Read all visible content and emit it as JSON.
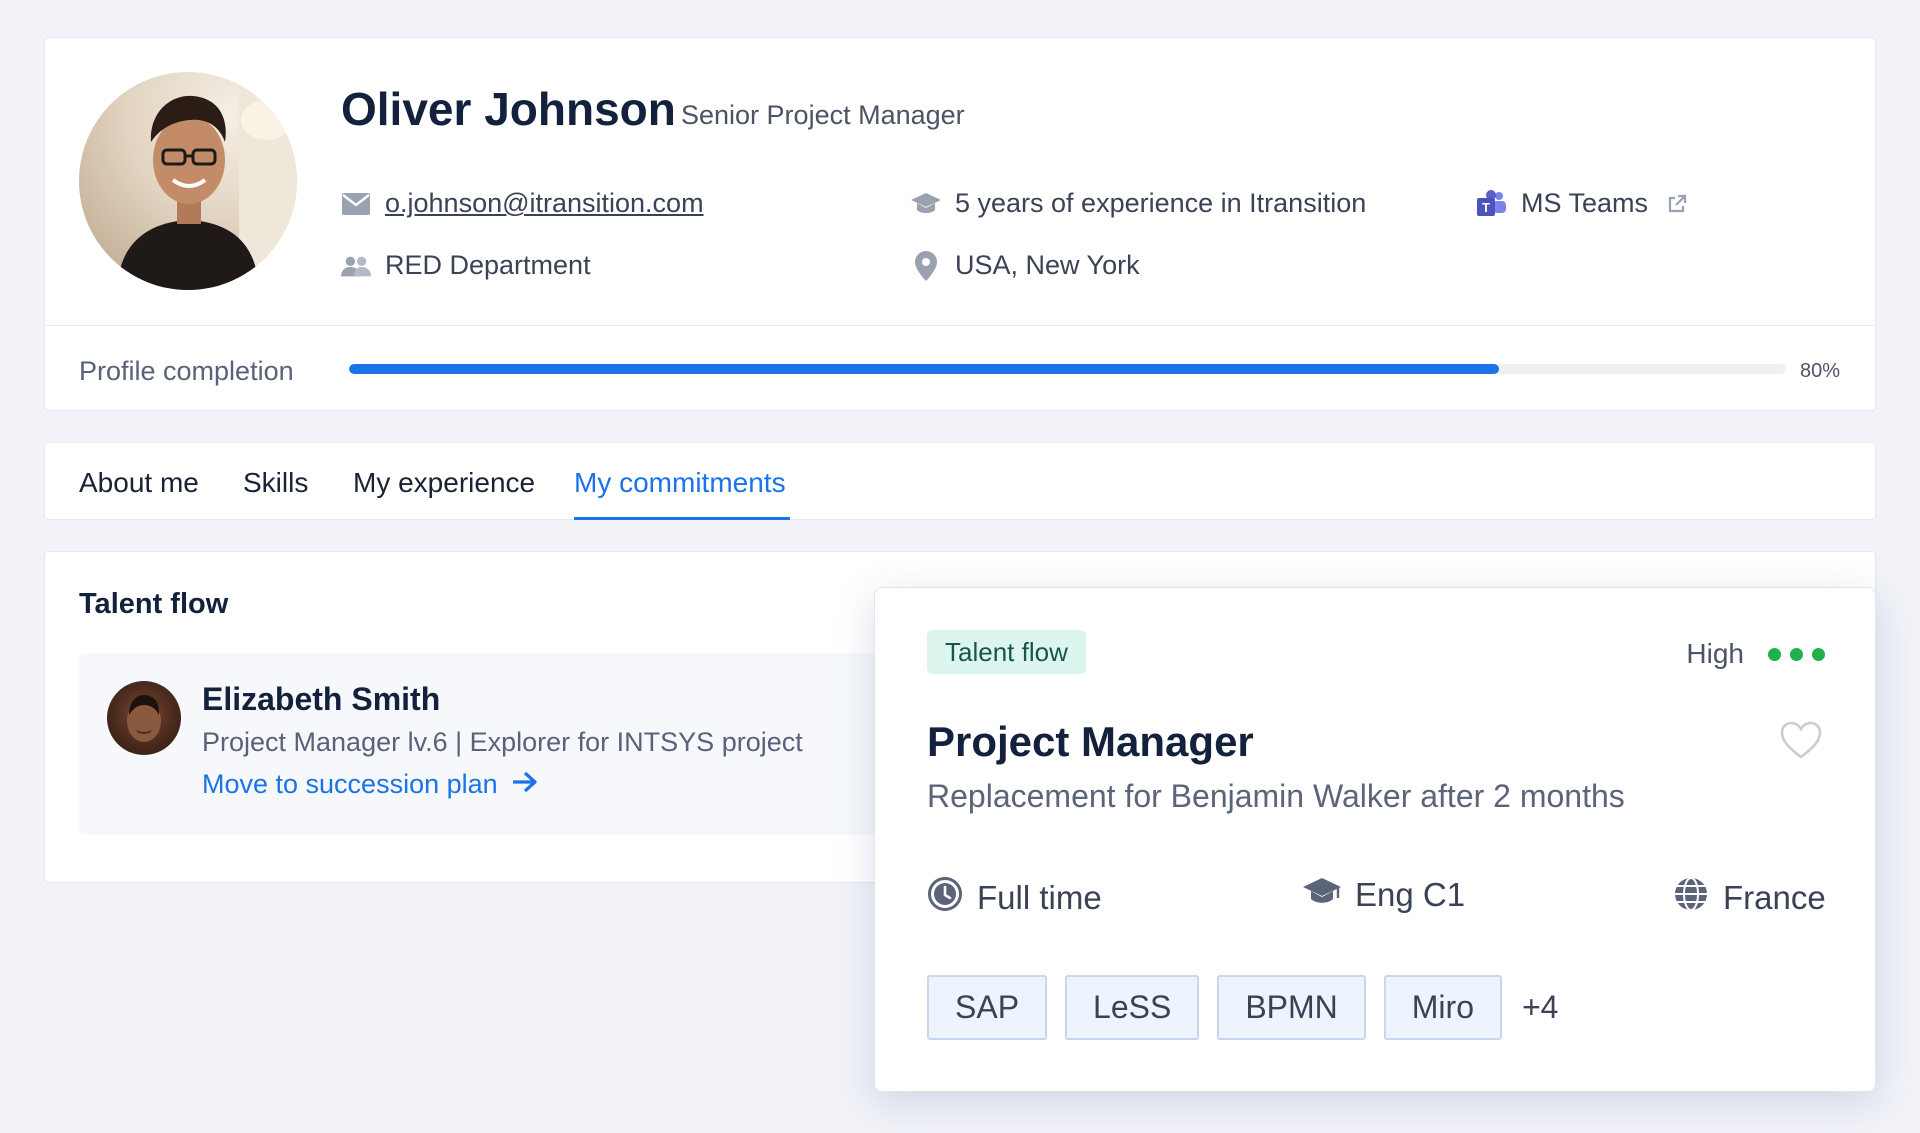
{
  "profile": {
    "name": "Oliver Johnson",
    "role": "Senior Project Manager",
    "email": "o.johnson@itransition.com",
    "experience": "5 years of experience in Itransition",
    "teams_label": "MS Teams",
    "department": "RED Department",
    "location": "USA, New York",
    "completion_label": "Profile completion",
    "completion_value": "80%",
    "completion_fraction": 0.8
  },
  "tabs": [
    {
      "label": "About me",
      "active": false
    },
    {
      "label": "Skills",
      "active": false
    },
    {
      "label": "My experience",
      "active": false
    },
    {
      "label": "My commitments",
      "active": true
    }
  ],
  "talent_flow": {
    "title": "Talent flow",
    "candidate": {
      "name": "Elizabeth Smith",
      "description": "Project Manager lv.6 | Explorer for INTSYS project",
      "action_label": "Move to succession plan"
    }
  },
  "popover": {
    "tag": "Talent flow",
    "priority": "High",
    "title": "Project Manager",
    "subtitle": "Replacement for Benjamin Walker after 2 months",
    "employment": "Full time",
    "language": "Eng C1",
    "country": "France",
    "skills": [
      "SAP",
      "LeSS",
      "BPMN",
      "Miro"
    ],
    "more_skills": "+4"
  },
  "colors": {
    "accent": "#1a73e8",
    "priority_dot": "#22b04b",
    "tag_bg": "#dcf5ee",
    "teams_purple": "#5b5fc7"
  },
  "icons": {
    "email": "envelope-icon",
    "experience": "graduation-cap-icon",
    "teams": "ms-teams-icon",
    "external": "external-link-icon",
    "department": "people-icon",
    "location": "map-pin-icon",
    "arrow": "arrow-right-icon",
    "favorite": "heart-icon",
    "employment": "clock-icon",
    "language": "graduation-cap-icon",
    "country": "globe-icon"
  }
}
